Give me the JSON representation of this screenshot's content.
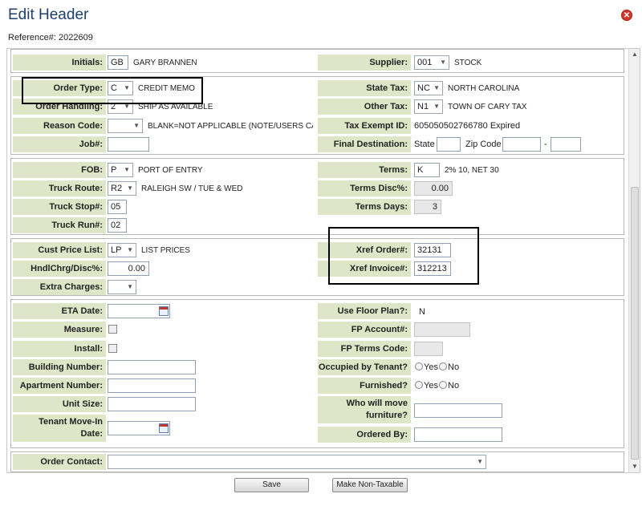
{
  "title": "Edit Header",
  "reference": "Reference#: 2022609",
  "close_icon": "close-icon",
  "sec1": {
    "initials_label": "Initials:",
    "initials_value": "GB",
    "initials_desc": "GARY BRANNEN",
    "supplier_label": "Supplier:",
    "supplier_value": "001",
    "supplier_desc": "STOCK"
  },
  "sec2": {
    "order_type_label": "Order Type:",
    "order_type_value": "C",
    "order_type_desc": "CREDIT MEMO",
    "order_handling_label": "Order Handling:",
    "order_handling_value": "2",
    "order_handling_desc": "SHIP AS AVAILABLE",
    "reason_code_label": "Reason Code:",
    "reason_code_value": "",
    "reason_code_desc": "BLANK=NOT APPLICABLE (NOTE/USERS CAN C",
    "job_label": "Job#:",
    "job_value": "",
    "state_tax_label": "State Tax:",
    "state_tax_value": "NC",
    "state_tax_desc": "NORTH CAROLINA",
    "other_tax_label": "Other Tax:",
    "other_tax_value": "N1",
    "other_tax_desc": "TOWN OF CARY TAX",
    "tax_exempt_label": "Tax Exempt ID:",
    "tax_exempt_value": "605050502766780 Expired",
    "final_dest_label": "Final Destination:",
    "state_text": "State",
    "state_value": "",
    "zip_text": "Zip Code",
    "zip_value": "",
    "zip_ext_value": "",
    "dash": "-"
  },
  "sec3": {
    "fob_label": "FOB:",
    "fob_value": "P",
    "fob_desc": "PORT OF ENTRY",
    "truck_route_label": "Truck Route:",
    "truck_route_value": "R2",
    "truck_route_desc": "RALEIGH SW / TUE & WED",
    "truck_stop_label": "Truck Stop#:",
    "truck_stop_value": "05",
    "truck_run_label": "Truck Run#:",
    "truck_run_value": "02",
    "terms_label": "Terms:",
    "terms_value": "K",
    "terms_desc": "2% 10, NET 30",
    "terms_disc_label": "Terms Disc%:",
    "terms_disc_value": "0.00",
    "terms_days_label": "Terms Days:",
    "terms_days_value": "3"
  },
  "sec4": {
    "cust_price_label": "Cust Price List:",
    "cust_price_value": "LP",
    "cust_price_desc": "LIST PRICES",
    "hndl_label": "HndlChrg/Disc%:",
    "hndl_value": "0.00",
    "extra_label": "Extra Charges:",
    "extra_value": "",
    "xref_order_label": "Xref Order#:",
    "xref_order_value": "32131",
    "xref_invoice_label": "Xref Invoice#:",
    "xref_invoice_value": "312213"
  },
  "sec5": {
    "eta_label": "ETA Date:",
    "eta_value": "",
    "measure_label": "Measure:",
    "install_label": "Install:",
    "building_label": "Building Number:",
    "building_value": "",
    "apartment_label": "Apartment Number:",
    "apartment_value": "",
    "unit_label": "Unit Size:",
    "unit_value": "",
    "tenant_label_1": "Tenant Move-In",
    "tenant_label_2": "Date:",
    "tenant_value": "",
    "floor_plan_label": "Use Floor Plan?:",
    "floor_plan_value": "N",
    "fp_account_label": "FP Account#:",
    "fp_account_value": "",
    "fp_terms_label": "FP Terms Code:",
    "fp_terms_value": "",
    "occupied_label": "Occupied by Tenant?",
    "yes_text": "Yes",
    "no_text": "No",
    "furnished_label": "Furnished?",
    "who_move_label_1": "Who will move",
    "who_move_label_2": "furniture?",
    "who_move_value": "",
    "ordered_by_label": "Ordered By:",
    "ordered_by_value": ""
  },
  "sec6": {
    "order_contact_label": "Order Contact:",
    "order_contact_value": ""
  },
  "buttons": {
    "save": "Save",
    "make_non_taxable": "Make Non-Taxable"
  }
}
